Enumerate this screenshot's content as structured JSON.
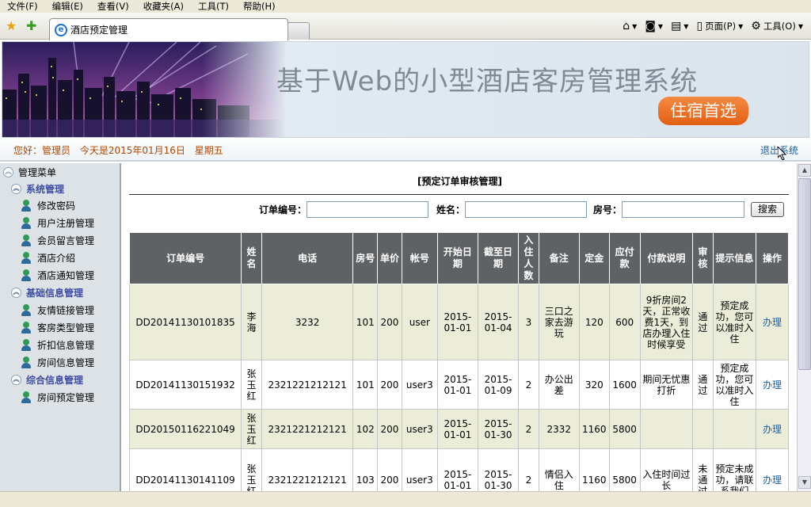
{
  "browser": {
    "menu": [
      "文件(F)",
      "编辑(E)",
      "查看(V)",
      "收藏夹(A)",
      "工具(T)",
      "帮助(H)"
    ],
    "tab_title": "酒店预定管理",
    "toolbar": {
      "page_label": "页面(P)",
      "tools_label": "工具(O)"
    }
  },
  "banner": {
    "title": "基于Web的小型酒店客房管理系统",
    "button": "住宿首选"
  },
  "greeting": {
    "hello": "您好：管理员",
    "today": "今天是2015年01月16日",
    "weekday": "星期五",
    "logout": "退出系统"
  },
  "sidebar": {
    "root": "管理菜单",
    "groups": [
      {
        "label": "系统管理",
        "items": [
          "修改密码",
          "用户注册管理",
          "会员留言管理",
          "酒店介绍",
          "酒店通知管理"
        ]
      },
      {
        "label": "基础信息管理",
        "items": [
          "友情链接管理",
          "客房类型管理",
          "折扣信息管理",
          "房间信息管理"
        ]
      },
      {
        "label": "综合信息管理",
        "items": [
          "房间预定管理"
        ]
      }
    ]
  },
  "main": {
    "title": "[预定订单审核管理]",
    "search": {
      "order_label": "订单编号：",
      "name_label": "姓名：",
      "room_label": "房号：",
      "button": "搜索"
    },
    "columns": [
      "订单编号",
      "姓名",
      "电话",
      "房号",
      "单价",
      "帐号",
      "开始日期",
      "截至日期",
      "入住人数",
      "备注",
      "定金",
      "应付款",
      "付款说明",
      "审核",
      "提示信息",
      "操作"
    ],
    "rows": [
      [
        "DD20141130101835",
        "李海",
        "3232",
        "101",
        "200",
        "user",
        "2015-01-01",
        "2015-01-04",
        "3",
        "三口之家去游玩",
        "120",
        "600",
        "9折房间2天，正常收费1天，到店办理入住时候享受",
        "通过",
        "预定成功，您可以准时入住",
        "办理"
      ],
      [
        "DD20141130151932",
        "张玉红",
        "2321221212121",
        "101",
        "200",
        "user3",
        "2015-01-01",
        "2015-01-09",
        "2",
        "办公出差",
        "320",
        "1600",
        "期间无忧惠打折",
        "通过",
        "预定成功，您可以准时入住",
        "办理"
      ],
      [
        "DD20150116221049",
        "张玉红",
        "2321221212121",
        "102",
        "200",
        "user3",
        "2015-01-01",
        "2015-01-30",
        "2",
        "2332",
        "1160",
        "5800",
        "",
        "",
        "",
        "办理"
      ],
      [
        "DD20141130141109",
        "张玉红",
        "2321221212121",
        "103",
        "200",
        "user3",
        "2015-01-01",
        "2015-01-30",
        "2",
        "情侣入住",
        "1160",
        "5800",
        "入住时间过长",
        "未通过",
        "预定未成功，请联系我们",
        "办理"
      ]
    ]
  }
}
